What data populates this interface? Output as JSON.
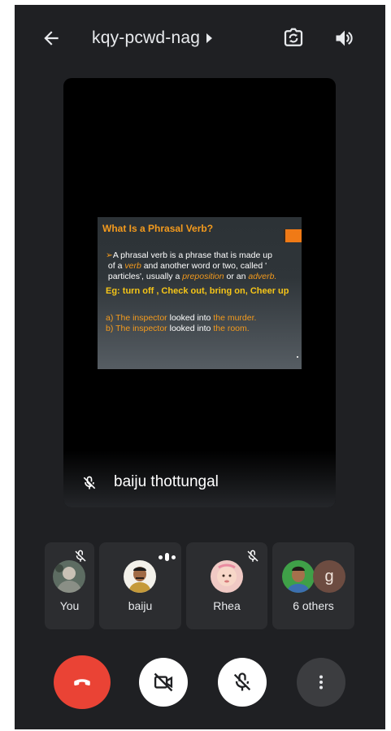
{
  "topbar": {
    "meeting_code": "kqy-pcwd-nag",
    "back_icon": "arrow-back-icon",
    "flip_icon": "flip-camera-icon",
    "speaker_icon": "speaker-icon"
  },
  "main_video": {
    "speaker_name": "baiju thottungal",
    "mic_icon": "mic-off-icon",
    "slide": {
      "title": "What Is a Phrasal Verb?",
      "line1_prefix": "A phrasal verb is a phrase that is made up",
      "line2_a": "of a ",
      "line2_verb": "verb",
      "line2_b": " and another word or two, called '",
      "line3_a": "particles', usually a ",
      "line3_prep": "preposition",
      "line3_b": " or an ",
      "line3_adv": "adverb.",
      "eg_label": "Eg: ",
      "eg_text": "turn off , Check out, bring on, Cheer up",
      "ex1_a": "a) The inspector",
      "ex1_b": " looked into ",
      "ex1_c": "the murder.",
      "ex2_a": "b) The inspector",
      "ex2_b": " looked into ",
      "ex2_c": "the room."
    }
  },
  "participants": [
    {
      "label": "You",
      "muted": true
    },
    {
      "label": "baiju",
      "speaking": true
    },
    {
      "label": "Rhea",
      "muted": true
    },
    {
      "label": "6 others",
      "initial": "g"
    }
  ],
  "controls": {
    "end_call_icon": "end-call-icon",
    "camera_icon": "camera-off-icon",
    "mic_icon": "mic-off-icon",
    "more_icon": "more-vertical-icon"
  },
  "colors": {
    "background": "#1f2023",
    "tile": "#2c2d30",
    "end_call": "#ea4335",
    "accent_orange": "#f39a1d"
  }
}
